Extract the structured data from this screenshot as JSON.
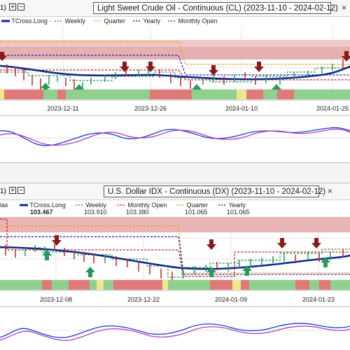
{
  "panels": [
    {
      "header_number": "1)",
      "plus_label": "+",
      "minus_label": "−",
      "title": "Light Sweet Crude Oil - Continuous (CL) (2023-11-10 - 2024-02-12)",
      "legend": [
        {
          "label": "TCross.Long",
          "color": "#0a2a8c"
        },
        {
          "label": "Weekly",
          "color": "#2a9a5a"
        },
        {
          "label": "Quarter",
          "color": "#f0a030"
        },
        {
          "label": "Yearly",
          "color": "#2020c0"
        },
        {
          "label": "Monthly Open",
          "color": "#cc2020"
        }
      ],
      "x_ticks": [
        "2023-12-11",
        "2023-12-26",
        "2024-01-10",
        "2024-01-25"
      ]
    },
    {
      "header_number": "1)",
      "plus_label": "+",
      "minus_label": "−",
      "title": "U.S. Dollar IDX - Continuous (DX) (2023-11-10 - 2024-02-12)",
      "legend": [
        {
          "label": "lax",
          "value": "",
          "color": "#333333"
        },
        {
          "label": "TCross.Long",
          "value": "103.467",
          "color": "#0a2a8c"
        },
        {
          "label": "Weekly",
          "value": "103.910",
          "color": "#2a9a5a"
        },
        {
          "label": "Monthly Open",
          "value": "103.380",
          "color": "#cc2020"
        },
        {
          "label": "Quarter",
          "value": "101.065",
          "color": "#f0a030"
        },
        {
          "label": "Yearly",
          "value": "101.065",
          "color": "#2020c0"
        }
      ],
      "x_ticks": [
        "2023-12-08",
        "2023-12-22",
        "2024-01-09",
        "2024-01-23"
      ]
    }
  ],
  "chart_data": [
    {
      "type": "line",
      "title": "Light Sweet Crude Oil - Continuous (CL) (2023-11-10 - 2024-02-12)",
      "x_tick_labels": [
        "2023-12-11",
        "2023-12-26",
        "2024-01-10",
        "2024-01-25"
      ],
      "series": [
        {
          "name": "TCross.Long",
          "values": [
            0.42,
            0.4,
            0.36,
            0.32,
            0.3,
            0.3,
            0.31,
            0.3,
            0.29,
            0.27,
            0.27,
            0.27,
            0.28,
            0.29,
            0.31,
            0.36
          ]
        },
        {
          "name": "Weekly",
          "values": [
            0.36,
            0.36,
            0.33,
            0.3,
            0.3,
            0.35,
            0.35,
            0.38,
            0.33,
            0.33,
            0.32,
            0.32,
            0.35,
            0.38,
            0.38,
            0.4
          ]
        },
        {
          "name": "Quarter",
          "values": [
            1.0,
            1.0,
            1.0,
            1.0,
            1.0,
            1.0,
            1.0,
            1.0,
            1.0,
            0.5,
            0.5,
            0.5,
            0.5,
            0.5,
            0.5,
            0.5
          ]
        },
        {
          "name": "Yearly",
          "values": [
            0.7,
            0.7,
            0.7,
            0.7,
            0.7,
            0.7,
            0.7,
            0.7,
            0.7,
            0.35,
            0.35,
            0.35,
            0.35,
            0.35,
            0.35,
            0.35
          ]
        },
        {
          "name": "Monthly Open",
          "values": [
            0.45,
            0.45,
            0.45,
            0.45,
            0.45,
            0.45,
            0.45,
            0.45,
            0.45,
            0.32,
            0.32,
            0.32,
            0.32,
            0.32,
            0.32,
            0.32
          ]
        }
      ]
    },
    {
      "type": "line",
      "title": "U.S. Dollar IDX - Continuous (DX) (2023-11-10 - 2024-02-12)",
      "x_tick_labels": [
        "2023-12-08",
        "2023-12-22",
        "2024-01-09",
        "2024-01-23"
      ],
      "series": [
        {
          "name": "TCross.Long",
          "values": [
            103.9,
            103.9,
            103.8,
            103.6,
            103.4,
            103.1,
            102.8,
            102.6,
            102.5,
            102.5,
            102.6,
            102.8,
            103.0,
            103.1,
            103.3,
            103.467
          ]
        },
        {
          "name": "Weekly",
          "values": [
            104.0,
            103.8,
            103.8,
            103.6,
            103.4,
            103.2,
            102.5,
            102.0,
            101.6,
            102.0,
            102.4,
            102.5,
            102.6,
            103.2,
            103.4,
            103.91
          ]
        },
        {
          "name": "Monthly Open",
          "values": [
            105.0,
            103.2,
            103.2,
            103.2,
            103.2,
            103.2,
            103.2,
            103.2,
            101.6,
            101.6,
            101.6,
            101.6,
            101.6,
            103.38,
            103.38,
            103.38
          ]
        },
        {
          "name": "Quarter",
          "values": [
            104.8,
            104.8,
            104.8,
            104.8,
            104.8,
            104.8,
            104.8,
            104.8,
            101.065,
            101.065,
            101.065,
            101.065,
            101.065,
            101.065,
            101.065,
            101.065
          ]
        },
        {
          "name": "Yearly",
          "values": [
            104.3,
            104.3,
            104.3,
            104.3,
            104.3,
            104.3,
            104.3,
            104.3,
            101.065,
            101.065,
            101.065,
            101.065,
            101.065,
            101.065,
            101.065,
            101.065
          ]
        }
      ]
    }
  ]
}
